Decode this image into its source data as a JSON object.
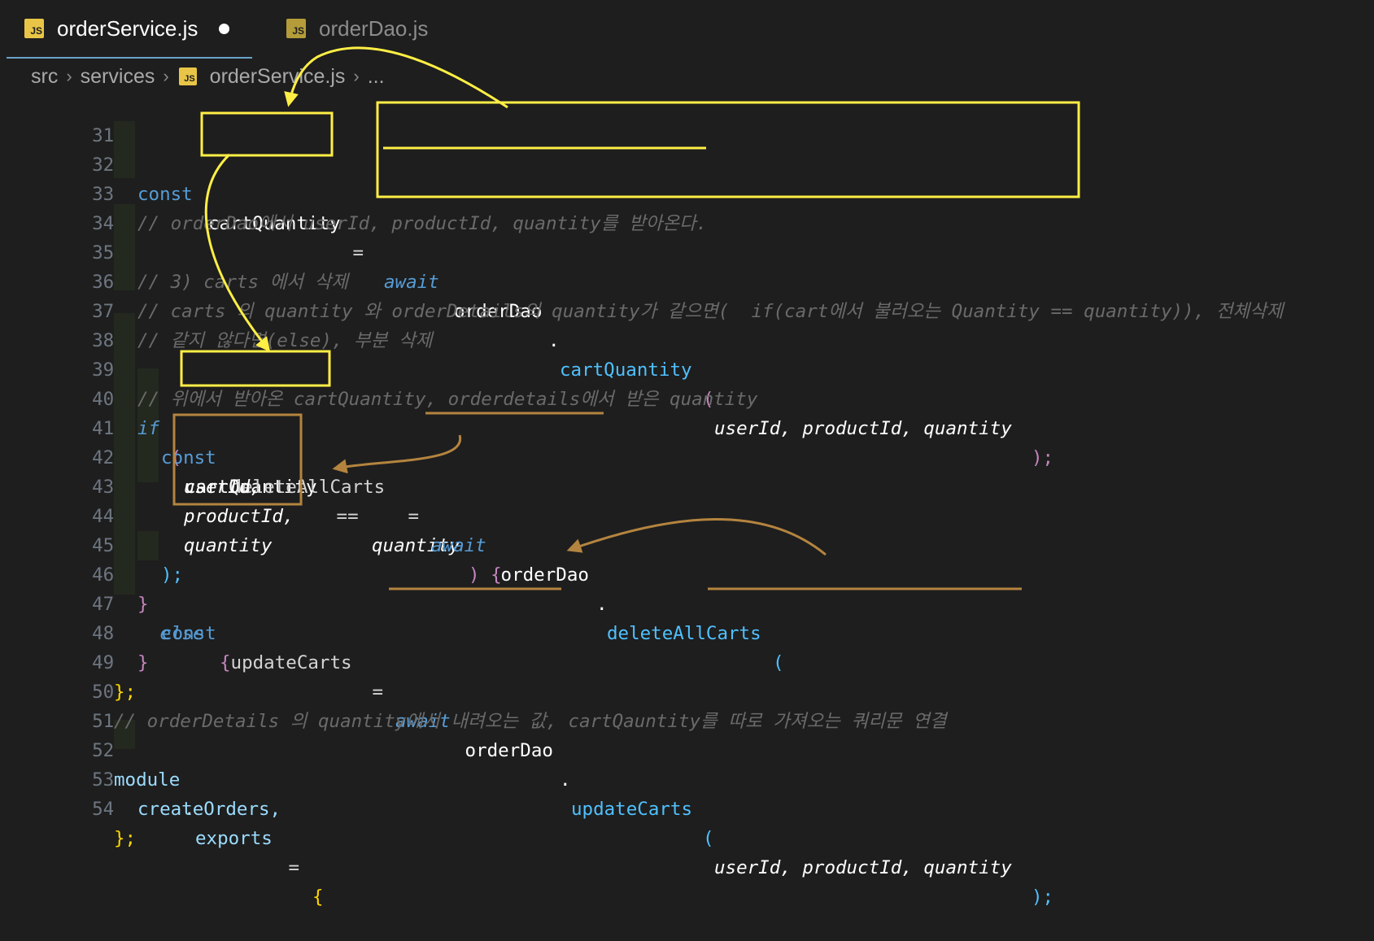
{
  "tabs": [
    {
      "label": "orderService.js",
      "icon": "js-file-icon",
      "modified": true,
      "active": true
    },
    {
      "label": "orderDao.js",
      "icon": "js-file-icon",
      "active": false
    }
  ],
  "js_icon_text": "JS",
  "breadcrumb": [
    "src",
    "services",
    "orderService.js",
    "..."
  ],
  "gutter": {
    "line_numbers": [
      "31",
      "32",
      "33",
      "34",
      "35",
      "36",
      "37",
      "38",
      "39",
      "40",
      "41",
      "42",
      "43",
      "44",
      "45",
      "46",
      "47",
      "48",
      "49",
      "50",
      "51",
      "52",
      "53",
      "54"
    ]
  },
  "code": {
    "l32": {
      "kw": "const",
      "var": "cartQuantity",
      "eq": " = ",
      "aw": "await",
      "obj": "orderDao",
      "dot": ".",
      "fn": "cartQuantity",
      "open": "(",
      "args": "userId, productId, quantity",
      "close": ");"
    },
    "l33": "// orderDao에서 userId, productId, quantity를 받아온다.",
    "l35": "// 3) carts 에서 삭제",
    "l36": "// carts 의 quantity 와 orderDetails의 quantity가 같으면(  if(cart에서 불러오는 Quantity == quantity)), 전체삭제",
    "l37": "// 같지 않다면(else), 부분 삭제",
    "l39": "// 위에서 받아온 cartQuantity, orderdetails에서 받은 quantity",
    "l40": {
      "if": "if",
      "open": " (",
      "var": "cartQuantity",
      "op": " == ",
      "arg": "quantity",
      "rest": ") {"
    },
    "l41": {
      "kw": "const",
      "var": " deleteAllCarts",
      "eq": " = ",
      "aw": "await",
      "obj": " orderDao",
      "dot": ".",
      "fn": "deleteAllCarts",
      "open": "("
    },
    "l42": "userId,",
    "l43": "productId,",
    "l44": "quantity",
    "l45": ");",
    "l46": {
      "close": "}",
      "else": " else ",
      "open": "{"
    },
    "l47": {
      "kw": "const",
      "var": " updateCarts",
      "eq": " = ",
      "aw": "await",
      "obj": " orderDao",
      "dot": ".",
      "fn": "updateCarts",
      "open": "(",
      "args": "userId, productId, quantity",
      "close": ");"
    },
    "l48": "}",
    "l49": "};",
    "l50": "// orderDetails 의 quantity에서 내려오는 값, cartQauntity를 따로 가져오는 쿼리문 연결",
    "l52": {
      "obj": "module",
      "dot": ".",
      "prop": "exports",
      "eq": " = ",
      "open": "{"
    },
    "l53": "createOrders,",
    "l54": "};"
  },
  "annotations": {
    "yellow": "#ffef45",
    "brown": "#b4843f"
  }
}
